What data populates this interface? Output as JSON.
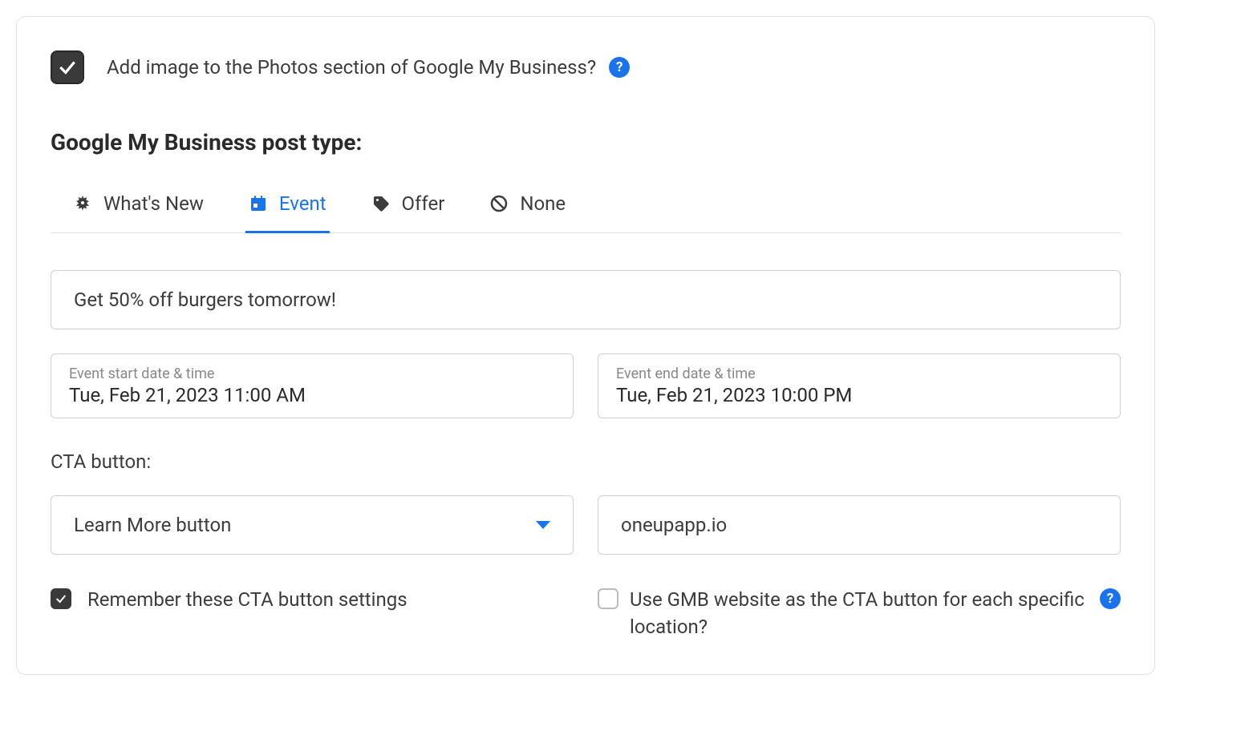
{
  "addImage": {
    "label": "Add image to the Photos section of Google My Business?",
    "checked": true
  },
  "postType": {
    "title": "Google My Business post type:",
    "tabs": [
      {
        "label": "What's New",
        "active": false
      },
      {
        "label": "Event",
        "active": true
      },
      {
        "label": "Offer",
        "active": false
      },
      {
        "label": "None",
        "active": false
      }
    ]
  },
  "event": {
    "title": "Get 50% off burgers tomorrow!",
    "start": {
      "label": "Event start date & time",
      "value": "Tue, Feb 21, 2023 11:00 AM"
    },
    "end": {
      "label": "Event end date & time",
      "value": "Tue, Feb 21, 2023 10:00 PM"
    }
  },
  "cta": {
    "label": "CTA button:",
    "selected": "Learn More button",
    "url": "oneupapp.io",
    "remember": {
      "label": "Remember these CTA button settings",
      "checked": true
    },
    "useGmbWebsite": {
      "label": "Use GMB website as the CTA button for each specific location?",
      "checked": false
    }
  }
}
